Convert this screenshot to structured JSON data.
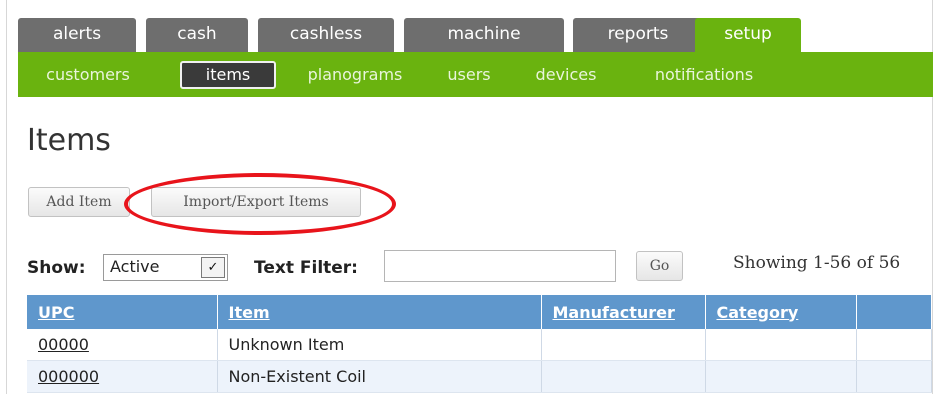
{
  "top_nav": {
    "tabs": [
      {
        "label": "alerts"
      },
      {
        "label": "cash"
      },
      {
        "label": "cashless"
      },
      {
        "label": "machine"
      },
      {
        "label": "reports"
      },
      {
        "label": "setup",
        "active": true
      }
    ]
  },
  "sub_nav": {
    "items": [
      {
        "label": "customers"
      },
      {
        "label": "items",
        "active": true
      },
      {
        "label": "planograms"
      },
      {
        "label": "users"
      },
      {
        "label": "devices"
      },
      {
        "label": "notifications"
      }
    ]
  },
  "page": {
    "title": "Items"
  },
  "actions": {
    "add_item": "Add Item",
    "import_export": "Import/Export Items"
  },
  "filters": {
    "show_label": "Show:",
    "show_value": "Active",
    "text_filter_label": "Text Filter:",
    "text_filter_value": "",
    "go_label": "Go",
    "showing_text": "Showing 1-56 of 56"
  },
  "table": {
    "columns": [
      "UPC",
      "Item",
      "Manufacturer",
      "Category",
      ""
    ],
    "rows": [
      {
        "upc": "00000",
        "item": "Unknown Item",
        "manufacturer": "",
        "category": ""
      },
      {
        "upc": "000000",
        "item": "Non-Existent Coil",
        "manufacturer": "",
        "category": ""
      }
    ]
  },
  "colors": {
    "nav_green": "#6ab30f",
    "tab_gray": "#6e6e6e",
    "header_blue": "#5f97cc",
    "highlight_red": "#e8141b"
  }
}
